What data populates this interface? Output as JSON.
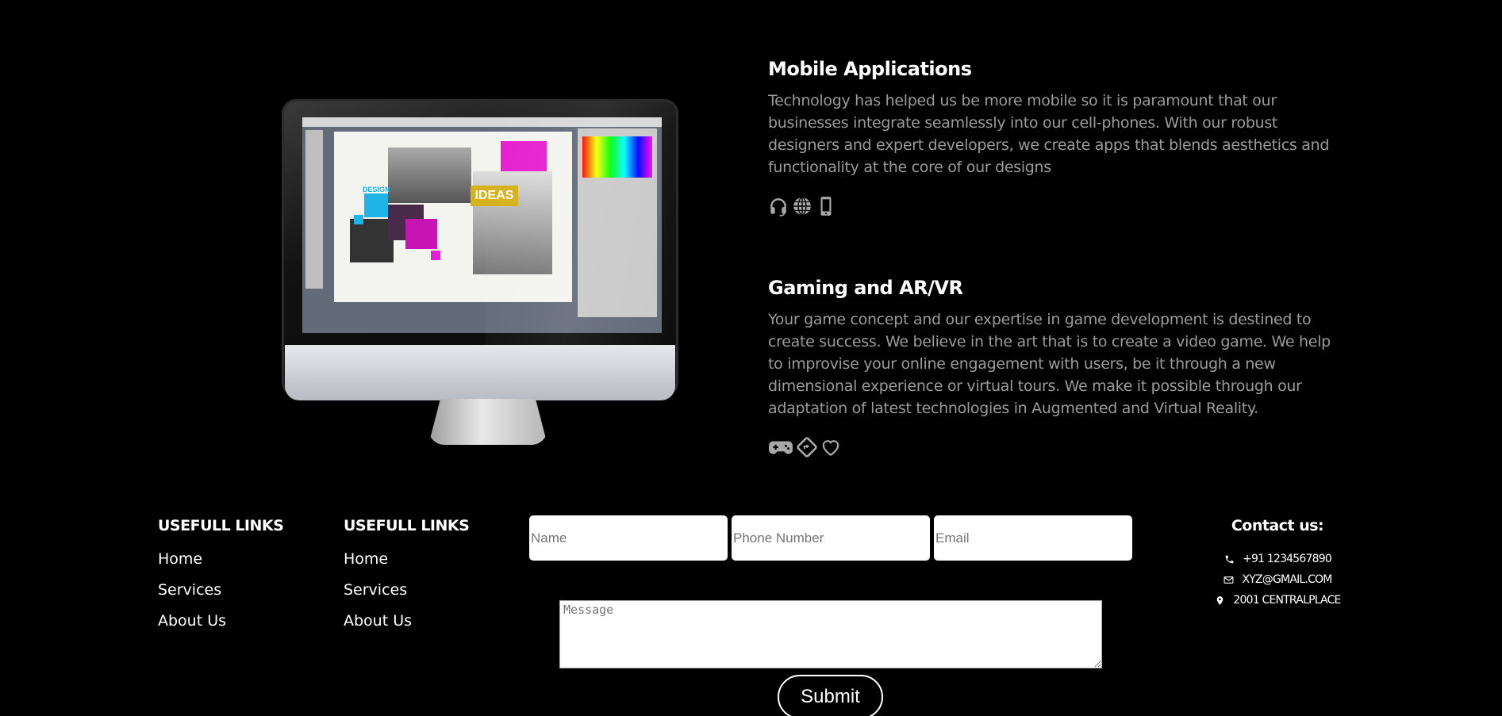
{
  "hero_image": {
    "canvas_text_ideas": "IDEAS",
    "canvas_text_design": "DESIGN"
  },
  "services": [
    {
      "title": "Mobile Applications",
      "description": "Technology has helped us be more mobile so it is paramount that our businesses integrate seamlessly into our cell-phones. With our robust designers and expert developers, we create apps that blends aesthetics and functionality at the core of our designs",
      "icons": [
        "headset-icon",
        "globe-icon",
        "mobile-phone-icon"
      ]
    },
    {
      "title": "Gaming and AR/VR",
      "description": "Your game concept and our expertise in game development is destined to create success. We believe in the art that is to create a video game. We help to improvise your online engagement with users, be it through a new dimensional experience or virtual tours. We make it possible through our adaptation of latest technologies in Augmented and Virtual Reality.",
      "icons": [
        "gamepad-icon",
        "diamond-direction-icon",
        "heart-icon"
      ]
    }
  ],
  "footer": {
    "links_1": {
      "heading": "USEFULL LINKS",
      "items": [
        "Home",
        "Services",
        "About Us"
      ]
    },
    "links_2": {
      "heading": "USEFULL LINKS",
      "items": [
        "Home",
        "Services",
        "About Us"
      ]
    },
    "form": {
      "name_placeholder": "Name",
      "phone_placeholder": "Phone Number",
      "email_placeholder": "Email",
      "message_placeholder": "Message",
      "submit_label": "Submit"
    },
    "contact": {
      "heading": "Contact us:",
      "phone": "+91 1234567890",
      "email": "XYZ@GMAIL.COM",
      "address": "2001 CENTRALPLACE"
    }
  },
  "colors": {
    "background": "#000000",
    "text": "#ffffff",
    "muted_text": "#9b9b9b",
    "icon_gray": "#a8a8a8"
  }
}
